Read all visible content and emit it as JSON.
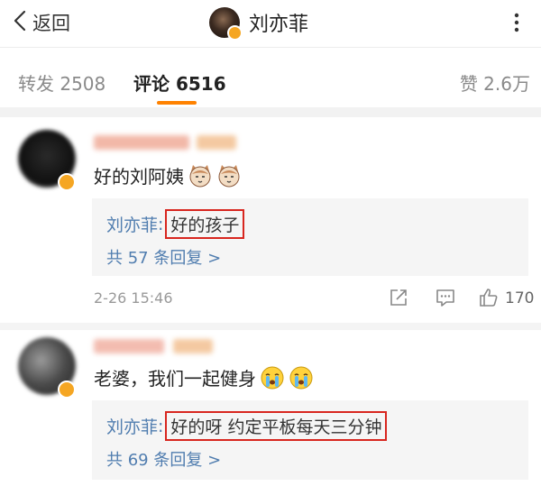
{
  "header": {
    "back_label": "返回",
    "title": "刘亦菲"
  },
  "tabs": {
    "repost": "转发 2508",
    "comment": "评论 6516",
    "like": "赞 2.6万"
  },
  "colors": {
    "accent": "#ff8200",
    "link": "#507daf",
    "highlight_box": "#d8261f"
  },
  "comments": [
    {
      "text": "好的刘阿姨",
      "emojis": [
        "cat-face-icon",
        "cat-face-icon"
      ],
      "reply": {
        "author": "刘亦菲",
        "colon": ":",
        "content": "好的孩子",
        "more": "共 57 条回复 >"
      },
      "time": "2-26 15:46",
      "like_count": "170"
    },
    {
      "text": "老婆，我们一起健身",
      "emojis": [
        "crying-face-icon",
        "crying-face-icon"
      ],
      "reply": {
        "author": "刘亦菲",
        "colon": ":",
        "content": "好的呀 约定平板每天三分钟",
        "more": "共 69 条回复 >"
      }
    }
  ]
}
